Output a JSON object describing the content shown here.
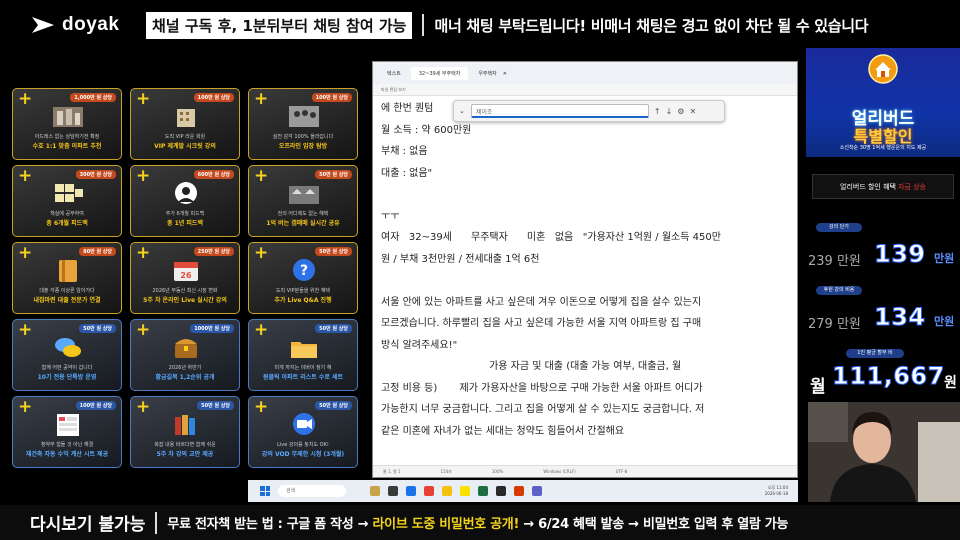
{
  "header": {
    "brand": "doyak",
    "notice_primary": "채널 구독 후, 1분뒤부터 채팅 참여 가능",
    "notice_secondary": "매너 채팅 부탁드립니다! 비매너 채팅은 경고 없이 차단 될 수 있습니다"
  },
  "products": [
    {
      "price": "1,000만 원 상당",
      "sub": "아드레스 없는 상담하기전 확정",
      "name": "수호 1:1 맞춤 아파트 추천",
      "style": "gold",
      "icon": "apartment-photo-icon"
    },
    {
      "price": "100만 원 상당",
      "sub": "도직 VIP 라운 회원",
      "name": "VIP 제계발 시크릿 강의",
      "style": "gold",
      "icon": "building-icon"
    },
    {
      "price": "100만 원 상당",
      "sub": "실전 감각 100% 올라갑니다",
      "name": "오프라인 임장 탐방",
      "style": "gold",
      "icon": "people-photo-icon"
    },
    {
      "price": "300만 원 상당",
      "sub": "책실에 공부하여",
      "name": "총 6개월 피드백",
      "style": "gold",
      "icon": "documents-icon"
    },
    {
      "price": "600만 원 상당",
      "sub": "추가 6개월 피드백",
      "name": "총 1년 피드백",
      "style": "gold",
      "icon": "avatar-icon"
    },
    {
      "price": "50만 원 상당",
      "sub": "전의 어디에도 없는 혜택",
      "name": "1억 버는 갭매매 실시간 공유",
      "style": "gold",
      "icon": "house-row-icon"
    },
    {
      "price": "80만 원 상당",
      "sub": "대출 각종 이상론 알아가다",
      "name": "내집마련 대출 전문가 연결",
      "style": "gold",
      "icon": "binder-icon"
    },
    {
      "price": "250만 원 상당",
      "sub": "2026년 부동산 최신 시장 변화",
      "name": "5주 차 온라인 Live 실시간 강의",
      "style": "gold",
      "icon": "calendar-icon"
    },
    {
      "price": "50만 원 상당",
      "sub": "도직 VIP분들을 위한 혜택",
      "name": "추가 Live Q&A 진행",
      "style": "gold",
      "icon": "question-bubble-icon"
    },
    {
      "price": "50만 원 상당",
      "sub": "함께 어떤 공약이 갑니다",
      "name": "10기 전용 단톡방 운영",
      "style": "blue",
      "icon": "chat-bubbles-icon"
    },
    {
      "price": "1000만 원 상당",
      "sub": "2026년 하반기",
      "name": "황금길목 1,2순위 공개",
      "style": "blue",
      "icon": "treasure-chest-icon"
    },
    {
      "price": "50만 원 상당",
      "sub": "미개 까지는 이버이 정기 혜",
      "name": "원클릭 아파트 리스트 수로 세트",
      "style": "blue",
      "icon": "folder-icon"
    },
    {
      "price": "100만 원 상당",
      "sub": "청약부 힘들 것 아닌 해결",
      "name": "재건축 자동 수익 계산 시트 제공",
      "style": "blue",
      "icon": "sheet-icon"
    },
    {
      "price": "50만 원 상당",
      "sub": "복잡 내용 바르다면 함께 쉬운",
      "name": "5주 차 강의 교안 제공",
      "style": "blue",
      "icon": "books-icon"
    },
    {
      "price": "50만 원 상당",
      "sub": "Live 강의를 놓치도 OK!",
      "name": "강의 VOD 무제한 시청 (3개월)",
      "style": "blue",
      "icon": "video-camera-icon"
    }
  ],
  "notepad": {
    "tabs": [
      "텍스트",
      "32~39세 무주택자",
      "우주택자"
    ],
    "menu": "파일   편집   보기",
    "find_placeholder": "제이조",
    "lines": [
      "에 한번 퀀텀",
      "월 소득 : 약 600만원",
      "부채 : 없음",
      "대출 : 없음\"",
      "",
      "ㅜㅜ",
      "여자   32~39세      무주택자      미혼   없음   \"가용자산 1억원 / 월소득 450만",
      "원 / 부채 3천만원 / 전세대출 1억 6천",
      "",
      "서울 안에 있는 아파트를 사고 싶은데 겨우 이돈으로 어떻게 집을 살수 있는지",
      "모르겠습니다. 하루빨리 집을 사고 싶은데 가능한 서울 지역 아파트랑 집 구매",
      "방식 알려주세요!\"",
      "                                  가용 자금 및 대출 (대출 가능 여부, 대출금, 월",
      "고정 비용 등)       제가 가용자산을 바탕으로 구매 가능한 서울 아파트 어디가",
      "가능한지 너무 궁금합니다. 그리고 집을 어떻게 살 수 있는지도 궁금합니다. 저",
      "같은 미혼에 자녀가 없는 세대는 청약도 힘들어서 간절해요"
    ],
    "status": [
      "줄 1, 열 1",
      "154자",
      "100%",
      "Windows (CRLF)",
      "UTF-8"
    ]
  },
  "taskbar": {
    "search_placeholder": "검색",
    "clock_time": "오후 11:04",
    "clock_date": "2026-06-18"
  },
  "ad": {
    "line1": "얼리버드",
    "line2": "특별할인",
    "line3": "소선착순 30명 1억세 행운운의 지도 제공"
  },
  "promo": {
    "text": "얼리버드 할인 혜택",
    "highlight": "자금 상승"
  },
  "stats": [
    {
      "tag": "강의 단가",
      "old": "239 만원",
      "big": "139",
      "unit": "만원"
    },
    {
      "tag": "후원 강의 비용",
      "old": "279 만원",
      "big": "134",
      "unit": "만원"
    },
    {
      "tag": "1인 평균 할부 비",
      "old": "월",
      "big": "111,667",
      "unit": "원"
    }
  ],
  "footer": {
    "left": "다시보기 불가능",
    "right_prefix": "무료 전자책 받는 법 : 구글 폼 작성 → ",
    "right_hl1": "라이브 도중 비밀번호 공개!",
    "right_suffix": " → 6/24 혜택 발송 → 비밀번호 입력 후 열람 가능"
  },
  "colors": {
    "accent_yellow": "#f5d21e",
    "accent_blue": "#2a66ff",
    "card_gold_border": "#c9a227",
    "card_blue_border": "#4a7ac0"
  }
}
